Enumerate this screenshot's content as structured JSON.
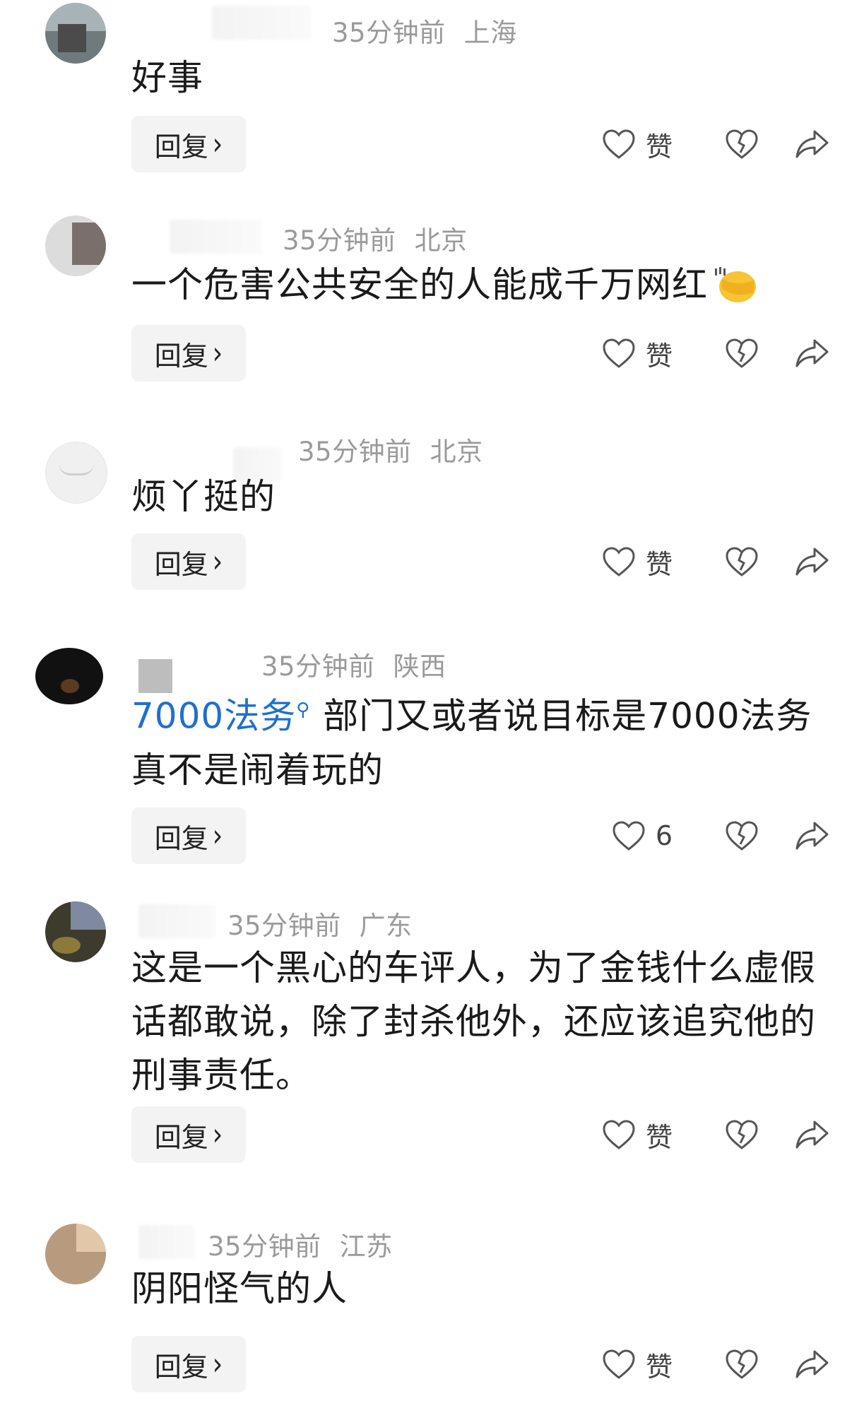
{
  "comments": [
    {
      "meta_time": "35分钟前",
      "meta_loc": "上海",
      "text": "好事",
      "reply_label": "回复",
      "like_label": "赞"
    },
    {
      "meta_time": "35分钟前",
      "meta_loc": "北京",
      "text": "一个危害公共安全的人能成千万网红",
      "reply_label": "回复",
      "like_label": "赞"
    },
    {
      "meta_time": "35分钟前",
      "meta_loc": "北京",
      "text": "烦丫挺的",
      "reply_label": "回复",
      "like_label": "赞"
    },
    {
      "meta_time": "35分钟前",
      "meta_loc": "陕西",
      "tag": "7000法务",
      "tag_icon": "search-icon",
      "text_after_tag": "部门又或者说目标是7000法务真不是闹着玩的",
      "reply_label": "回复",
      "like_label": "6"
    },
    {
      "meta_time": "35分钟前",
      "meta_loc": "广东",
      "text": "这是一个黑心的车评人，为了金钱什么虚假话都敢说，除了封杀他外，还应该追究他的刑事责任。",
      "reply_label": "回复",
      "like_label": "赞"
    },
    {
      "meta_time": "35分钟前",
      "meta_loc": "江苏",
      "text": "阴阳怪气的人",
      "reply_label": "回复",
      "like_label": "赞"
    }
  ],
  "icons": {
    "reply_chevron": "›",
    "like": "heart-outline-icon",
    "dislike": "broken-heart-icon",
    "share": "share-arrow-icon"
  },
  "colors": {
    "meta": "#9a9a9a",
    "tag": "#1f6fd0",
    "button_bg": "#f3f3f3"
  }
}
